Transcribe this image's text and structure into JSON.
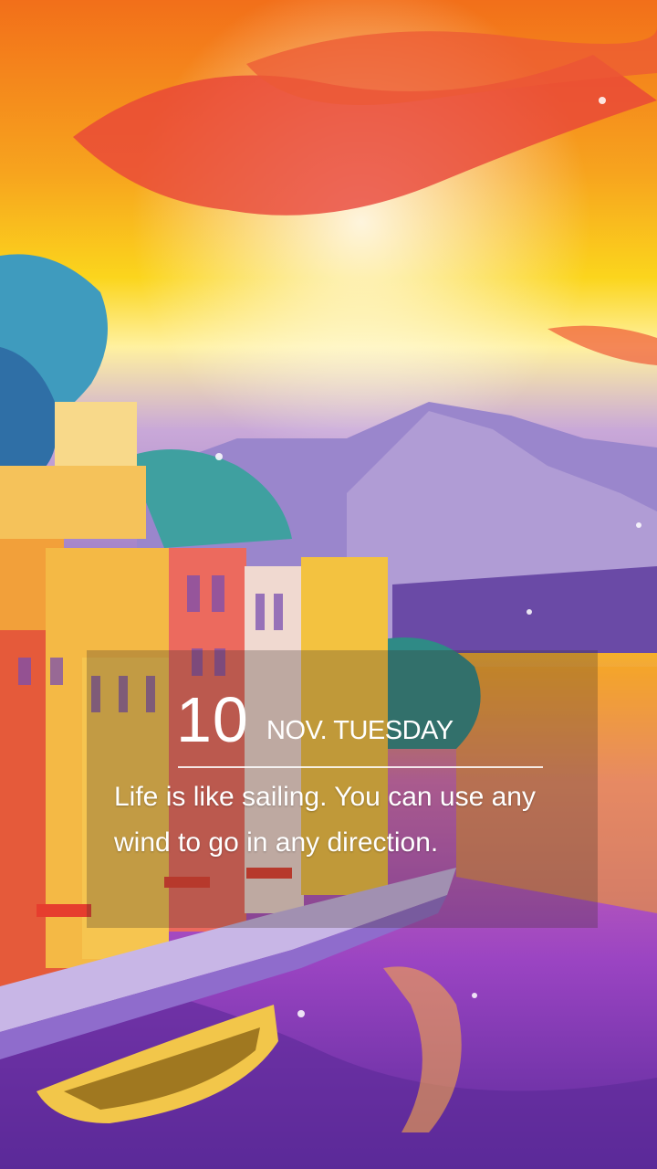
{
  "lockscreen": {
    "day": "10",
    "month_weekday": "NOV. TUESDAY",
    "quote": "Life is like sailing. You can use any wind to go in any direction."
  },
  "wallpaper": {
    "name": "coastal-town-sunset-illustration",
    "colors": {
      "sky_top": "#f7861e",
      "sky_mid": "#f9c51a",
      "clouds": "#e84a3a",
      "mountain": "#8b7ac8",
      "water": "#b34fc0",
      "buildings_warm": "#f2a03a"
    }
  }
}
